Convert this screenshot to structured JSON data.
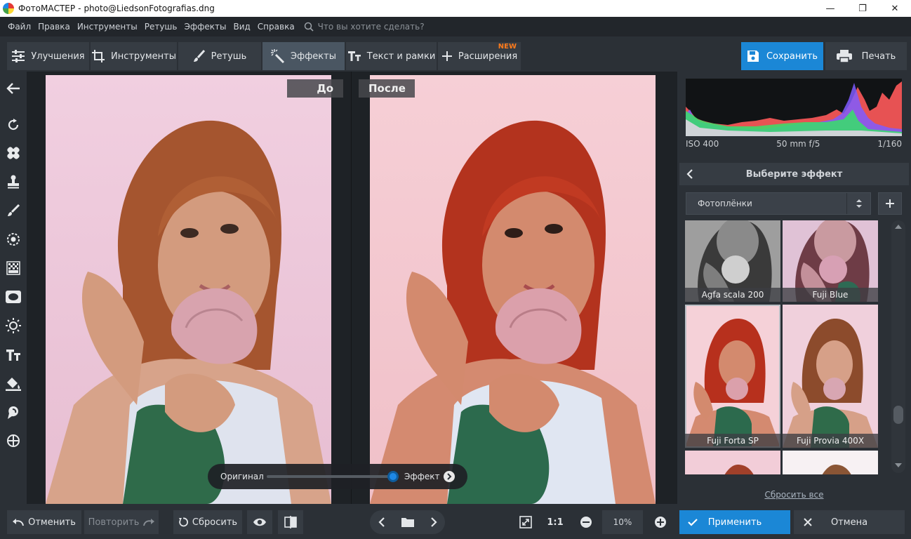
{
  "window": {
    "app_name": "ФотоМАСТЕР",
    "separator": "-",
    "file_name": "photo@LiedsonFotografias.dng",
    "controls": {
      "minimize": "—",
      "maximize": "❐",
      "close": "✕"
    }
  },
  "menu": {
    "items": [
      "Файл",
      "Правка",
      "Инструменты",
      "Ретушь",
      "Эффекты",
      "Вид",
      "Справка"
    ],
    "search_placeholder": "Что вы хотите сделать?"
  },
  "tabs": [
    {
      "label": "Улучшения",
      "icon": "sliders-icon",
      "active": false
    },
    {
      "label": "Инструменты",
      "icon": "crop-icon",
      "active": false
    },
    {
      "label": "Ретушь",
      "icon": "brush-icon",
      "active": false
    },
    {
      "label": "Эффекты",
      "icon": "magic-wand-icon",
      "active": true
    },
    {
      "label": "Текст и рамки",
      "icon": "text-icon",
      "active": false
    },
    {
      "label": "Расширения",
      "icon": "plus-icon",
      "active": false,
      "badge": "NEW"
    }
  ],
  "actions": {
    "save": "Сохранить",
    "print": "Печать"
  },
  "left_tools": [
    "back-arrow-icon",
    "rotate-icon",
    "healing-patch-icon",
    "stamp-icon",
    "brush-icon",
    "radial-filter-icon",
    "gradient-filter-icon",
    "vignette-icon",
    "light-icon",
    "text-icon",
    "fill-bucket-icon",
    "liquify-icon",
    "crosshair-icon"
  ],
  "canvas": {
    "before_label": "До",
    "after_label": "После",
    "compare": {
      "left_label": "Оригинал",
      "right_label": "Эффект",
      "strength": 1.0
    }
  },
  "histogram": {
    "iso": "ISO 400",
    "lens": "50 mm f/5",
    "shutter": "1/160"
  },
  "effects_panel": {
    "title": "Выберите эффект",
    "category": "Фотоплёнки",
    "items": [
      {
        "label": "Agfa scala 200"
      },
      {
        "label": "Fuji Blue"
      },
      {
        "label": "Fuji Forta SP",
        "selected": true
      },
      {
        "label": "Fuji Provia 400X"
      },
      {
        "label": ""
      },
      {
        "label": ""
      }
    ],
    "reset_all": "Сбросить все"
  },
  "bottom": {
    "undo": "Отменить",
    "redo": "Повторить",
    "reset": "Сбросить",
    "zoom_1to1": "1:1",
    "zoom_value": "10%",
    "apply": "Применить",
    "cancel": "Отмена"
  },
  "colors": {
    "accent": "#1b87d6",
    "badge": "#ff7b1c",
    "panel": "#2b3036",
    "button": "#363c43"
  }
}
